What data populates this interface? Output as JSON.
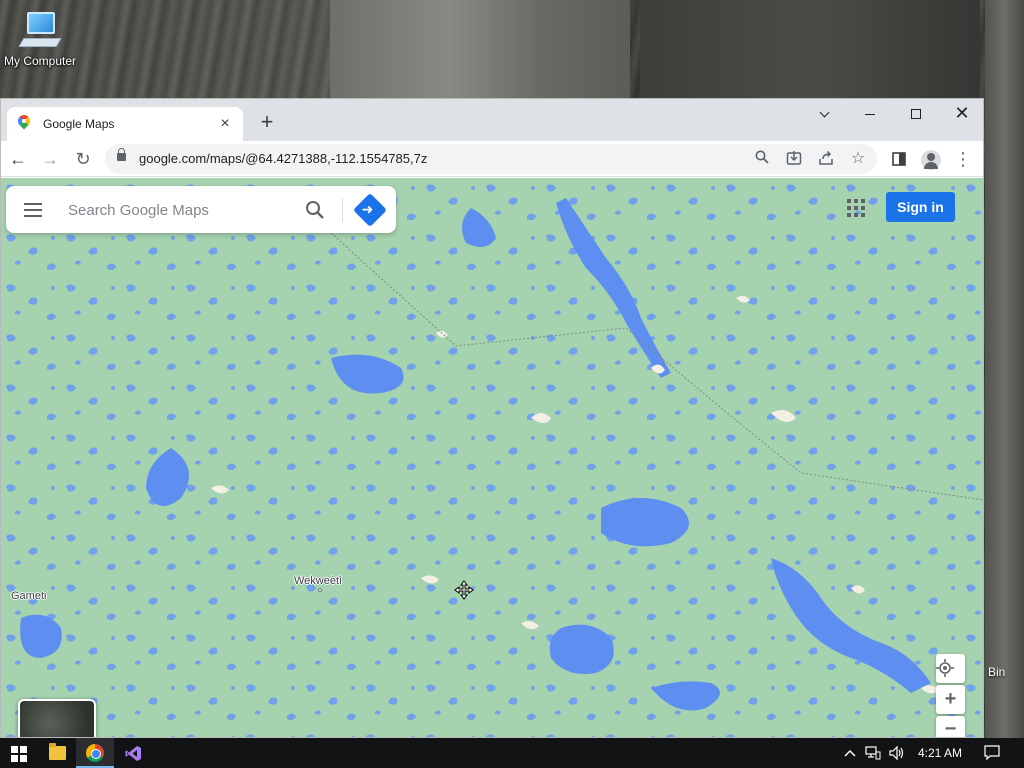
{
  "desktop": {
    "icons": [
      {
        "label": "My Computer"
      }
    ],
    "partial_label": "Bin"
  },
  "browser": {
    "tab": {
      "title": "Google Maps"
    },
    "newtab_symbol": "+",
    "tab_close_symbol": "×",
    "address": "google.com/maps/@64.4271388,-112.1554785,7z",
    "nav": {
      "back": "←",
      "forward": "→",
      "reload": "↻",
      "menu": "⋮"
    }
  },
  "maps": {
    "search_placeholder": "Search Google Maps",
    "signin_label": "Sign in",
    "places": [
      {
        "name": "Wekweètì"
      },
      {
        "name": "Gameti"
      }
    ],
    "zoom_in": "+",
    "zoom_out": "−",
    "colors": {
      "land": "#a8d4b2",
      "water": "#5e8ef0",
      "accent": "#1a73e8"
    }
  },
  "taskbar": {
    "time": "4:21 AM",
    "pinned": [
      "start-button",
      "file-explorer",
      "google-chrome",
      "visual-studio"
    ]
  }
}
